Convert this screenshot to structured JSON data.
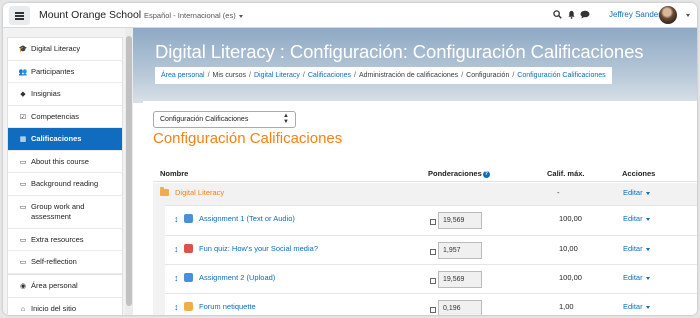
{
  "navbar": {
    "site_name": "Mount Orange School",
    "language": "Español - Internacional (es)",
    "user_name": "Jeffrey Sanders",
    "icons": [
      "menu-icon",
      "search-icon",
      "bell-icon",
      "chat-icon"
    ]
  },
  "sidebar": {
    "course_items": [
      {
        "icon": "mortarboard-icon",
        "glyph": "🎓",
        "label": "Digital Literacy"
      },
      {
        "icon": "users-icon",
        "glyph": "👥",
        "label": "Participantes"
      },
      {
        "icon": "badge-icon",
        "glyph": "◆",
        "label": "Insignias"
      },
      {
        "icon": "check-square-icon",
        "glyph": "☑",
        "label": "Competencias"
      },
      {
        "icon": "table-icon",
        "glyph": "▦",
        "label": "Calificaciones",
        "active": true
      },
      {
        "icon": "folder-icon",
        "glyph": "▭",
        "label": "About this course"
      },
      {
        "icon": "folder-icon",
        "glyph": "▭",
        "label": "Background reading"
      },
      {
        "icon": "folder-icon",
        "glyph": "▭",
        "label": "Group work and assessment"
      },
      {
        "icon": "folder-icon",
        "glyph": "▭",
        "label": "Extra resources"
      },
      {
        "icon": "folder-icon",
        "glyph": "▭",
        "label": "Self-reflection"
      }
    ],
    "site_items": [
      {
        "icon": "dashboard-icon",
        "glyph": "◉",
        "label": "Área personal"
      },
      {
        "icon": "home-icon",
        "glyph": "⌂",
        "label": "Inicio del sitio"
      }
    ]
  },
  "header": {
    "title": "Digital Literacy : Configuración: Configuración Calificaciones",
    "breadcrumb": [
      {
        "label": "Área personal",
        "link": true
      },
      {
        "label": "Mis cursos",
        "link": false
      },
      {
        "label": "Digital Literacy",
        "link": true
      },
      {
        "label": "Calificaciones",
        "link": true
      },
      {
        "label": "Administración de calificaciones",
        "link": false
      },
      {
        "label": "Configuración",
        "link": false
      },
      {
        "label": "Configuración Calificaciones",
        "link": true
      }
    ]
  },
  "main": {
    "select_value": "Configuración Calificaciones",
    "page_title": "Configuración Calificaciones",
    "columns": {
      "name": "Nombre",
      "weights": "Ponderaciones",
      "max_grade": "Calif. máx.",
      "actions": "Acciones"
    },
    "category": {
      "name": "Digital Literacy",
      "max_grade": "-",
      "action": "Editar"
    },
    "items": [
      {
        "name": "Assignment 1 (Text or Audio)",
        "icon": "assignment-icon",
        "icon_color": "#4a90d9",
        "weight": "19,569",
        "max_grade": "100,00",
        "action": "Editar"
      },
      {
        "name": "Fun quiz: How's your Social media?",
        "icon": "quiz-icon",
        "icon_color": "#d9534f",
        "weight": "1,957",
        "max_grade": "10,00",
        "action": "Editar"
      },
      {
        "name": "Assignment 2 (Upload)",
        "icon": "assignment-icon",
        "icon_color": "#4a90d9",
        "weight": "19,569",
        "max_grade": "100,00",
        "action": "Editar"
      },
      {
        "name": "Forum netiquette",
        "icon": "forum-icon",
        "icon_color": "#f0ad4e",
        "weight": "0,196",
        "max_grade": "1,00",
        "action": "Editar"
      }
    ]
  }
}
